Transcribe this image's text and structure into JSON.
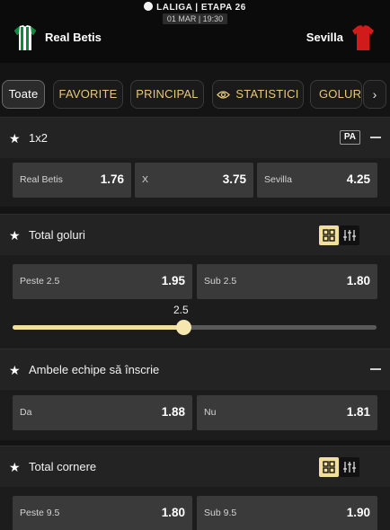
{
  "header": {
    "league": "LALIGA | ETAPA 26",
    "datetime": "01 MAR | 19:30",
    "home_team": "Real Betis",
    "away_team": "Sevilla",
    "home_colors": [
      "#0f8a3c",
      "#ffffff"
    ],
    "away_color": "#d11a1a"
  },
  "tabs": [
    {
      "label": "Toate",
      "active": true
    },
    {
      "label": "FAVORITE"
    },
    {
      "label": "PRINCIPAL"
    },
    {
      "label": "STATISTICI",
      "icon": "eye-icon"
    },
    {
      "label": "GOLURI"
    }
  ],
  "next_icon": "chevron-right-icon",
  "markets": {
    "m1x2": {
      "title": "1x2",
      "badge": "PA",
      "outcomes": [
        {
          "label": "Real Betis",
          "odd": "1.76"
        },
        {
          "label": "X",
          "odd": "3.75"
        },
        {
          "label": "Sevilla",
          "odd": "4.25"
        }
      ]
    },
    "total_goals": {
      "title": "Total goluri",
      "outcomes": [
        {
          "label": "Peste 2.5",
          "odd": "1.95"
        },
        {
          "label": "Sub 2.5",
          "odd": "1.80"
        }
      ],
      "slider_value": "2.5",
      "slider_fraction": 0.47
    },
    "btts": {
      "title": "Ambele echipe să înscrie",
      "outcomes": [
        {
          "label": "Da",
          "odd": "1.88"
        },
        {
          "label": "Nu",
          "odd": "1.81"
        }
      ]
    },
    "corners": {
      "title": "Total cornere",
      "outcomes": [
        {
          "label": "Peste 9.5",
          "odd": "1.80"
        },
        {
          "label": "Sub 9.5",
          "odd": "1.90"
        }
      ]
    }
  },
  "accent_color": "#f3df9c"
}
